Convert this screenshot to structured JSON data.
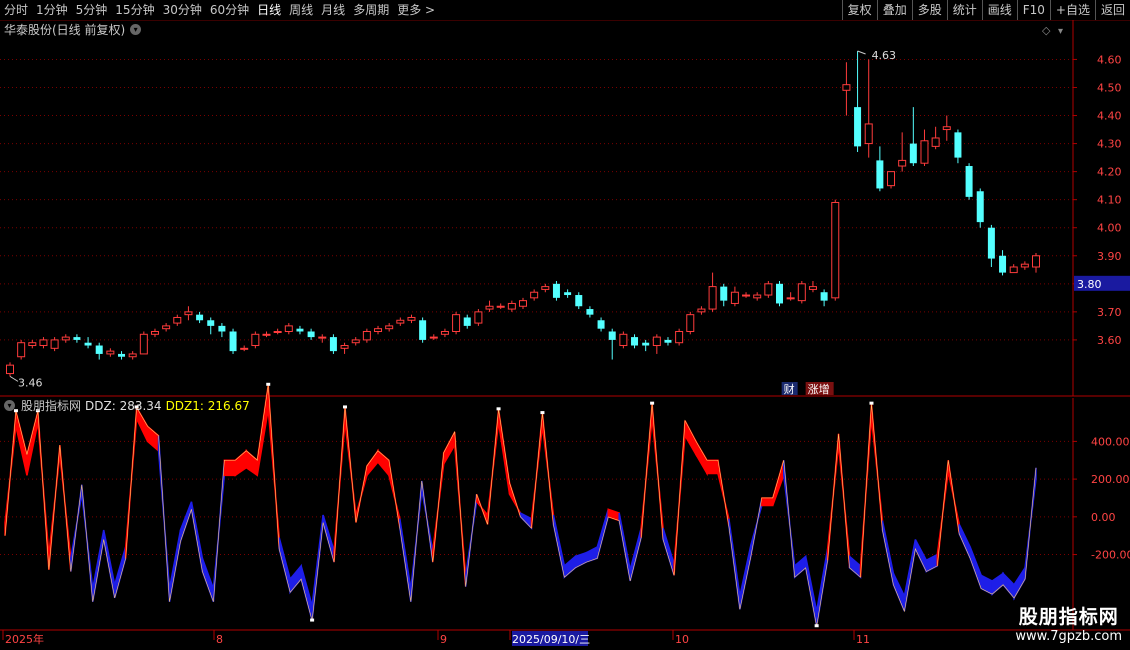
{
  "toolbar": {
    "left_items": [
      "分时",
      "1分钟",
      "5分钟",
      "15分钟",
      "30分钟",
      "60分钟",
      "日线",
      "周线",
      "月线",
      "多周期",
      "更多 >"
    ],
    "active_index": 6,
    "right_items": [
      "复权",
      "叠加",
      "多股",
      "统计",
      "画线",
      "F10",
      "+自选",
      "返回"
    ]
  },
  "title": "华泰股份(日线 前复权)",
  "indicator": {
    "name": "股朋指标网",
    "ddz_label": "DDZ: 283.34",
    "ddz1_label": "DDZ1: 216.67"
  },
  "badges": {
    "cai": "财",
    "zhangzeng": "涨增"
  },
  "watermark": {
    "line1": "股朋指标网",
    "line2": "www.7gpzb.com"
  },
  "colors": {
    "up": "#ff3c3c",
    "down": "#54ffff",
    "grid": "#7a0000",
    "axis_text": "#ff4444",
    "ddz_pos": "#ff0000",
    "ddz_neg": "#1e1ee8",
    "current_price_bg": "#1a1aa0"
  },
  "chart_data": [
    {
      "type": "candlestick",
      "title": "华泰股份(日线 前复权)",
      "y_ticks": [
        "4.60",
        "4.50",
        "4.40",
        "4.30",
        "4.20",
        "4.10",
        "4.00",
        "3.90",
        "3.80",
        "3.70",
        "3.60"
      ],
      "ylim": [
        3.4,
        4.68
      ],
      "grid": true,
      "max_label": "4.63",
      "min_label": "3.46",
      "current_price": "3.80",
      "x_labels": [
        "2025年",
        "8",
        "9",
        "2025/09/10/三",
        "10",
        "11"
      ],
      "candles": [
        [
          3.48,
          3.51,
          3.47,
          3.52
        ],
        [
          3.54,
          3.59,
          3.53,
          3.6
        ],
        [
          3.58,
          3.59,
          3.57,
          3.6
        ],
        [
          3.58,
          3.6,
          3.57,
          3.61
        ],
        [
          3.57,
          3.6,
          3.56,
          3.61
        ],
        [
          3.6,
          3.61,
          3.59,
          3.62
        ],
        [
          3.61,
          3.6,
          3.59,
          3.62
        ],
        [
          3.59,
          3.58,
          3.57,
          3.61
        ],
        [
          3.58,
          3.55,
          3.53,
          3.59
        ],
        [
          3.55,
          3.56,
          3.54,
          3.57
        ],
        [
          3.55,
          3.54,
          3.53,
          3.56
        ],
        [
          3.54,
          3.55,
          3.53,
          3.56
        ],
        [
          3.55,
          3.62,
          3.55,
          3.63
        ],
        [
          3.62,
          3.63,
          3.61,
          3.64
        ],
        [
          3.64,
          3.65,
          3.63,
          3.66
        ],
        [
          3.66,
          3.68,
          3.65,
          3.69
        ],
        [
          3.69,
          3.7,
          3.67,
          3.72
        ],
        [
          3.69,
          3.67,
          3.66,
          3.7
        ],
        [
          3.67,
          3.65,
          3.62,
          3.68
        ],
        [
          3.65,
          3.63,
          3.61,
          3.66
        ],
        [
          3.63,
          3.56,
          3.55,
          3.64
        ],
        [
          3.57,
          3.57,
          3.56,
          3.58
        ],
        [
          3.58,
          3.62,
          3.57,
          3.63
        ],
        [
          3.62,
          3.62,
          3.61,
          3.63
        ],
        [
          3.63,
          3.63,
          3.62,
          3.64
        ],
        [
          3.63,
          3.65,
          3.62,
          3.66
        ],
        [
          3.64,
          3.63,
          3.62,
          3.65
        ],
        [
          3.63,
          3.61,
          3.6,
          3.64
        ],
        [
          3.61,
          3.61,
          3.59,
          3.62
        ],
        [
          3.61,
          3.56,
          3.55,
          3.62
        ],
        [
          3.57,
          3.58,
          3.55,
          3.59
        ],
        [
          3.59,
          3.6,
          3.58,
          3.61
        ],
        [
          3.6,
          3.63,
          3.59,
          3.64
        ],
        [
          3.63,
          3.64,
          3.62,
          3.65
        ],
        [
          3.64,
          3.65,
          3.63,
          3.66
        ],
        [
          3.66,
          3.67,
          3.65,
          3.68
        ],
        [
          3.67,
          3.68,
          3.66,
          3.69
        ],
        [
          3.67,
          3.6,
          3.59,
          3.68
        ],
        [
          3.61,
          3.61,
          3.6,
          3.62
        ],
        [
          3.62,
          3.63,
          3.61,
          3.64
        ],
        [
          3.63,
          3.69,
          3.62,
          3.7
        ],
        [
          3.68,
          3.65,
          3.64,
          3.69
        ],
        [
          3.66,
          3.7,
          3.65,
          3.71
        ],
        [
          3.71,
          3.72,
          3.7,
          3.74
        ],
        [
          3.72,
          3.72,
          3.71,
          3.73
        ],
        [
          3.71,
          3.73,
          3.7,
          3.74
        ],
        [
          3.72,
          3.74,
          3.71,
          3.75
        ],
        [
          3.75,
          3.77,
          3.74,
          3.78
        ],
        [
          3.78,
          3.79,
          3.77,
          3.8
        ],
        [
          3.8,
          3.75,
          3.74,
          3.81
        ],
        [
          3.77,
          3.76,
          3.75,
          3.78
        ],
        [
          3.76,
          3.72,
          3.71,
          3.77
        ],
        [
          3.71,
          3.69,
          3.68,
          3.72
        ],
        [
          3.67,
          3.64,
          3.63,
          3.68
        ],
        [
          3.63,
          3.6,
          3.53,
          3.64
        ],
        [
          3.58,
          3.62,
          3.57,
          3.63
        ],
        [
          3.61,
          3.58,
          3.57,
          3.62
        ],
        [
          3.59,
          3.58,
          3.56,
          3.6
        ],
        [
          3.58,
          3.61,
          3.55,
          3.62
        ],
        [
          3.6,
          3.59,
          3.58,
          3.61
        ],
        [
          3.59,
          3.63,
          3.58,
          3.64
        ],
        [
          3.63,
          3.69,
          3.62,
          3.7
        ],
        [
          3.7,
          3.71,
          3.69,
          3.72
        ],
        [
          3.71,
          3.79,
          3.7,
          3.84
        ],
        [
          3.79,
          3.74,
          3.72,
          3.8
        ],
        [
          3.73,
          3.77,
          3.72,
          3.79
        ],
        [
          3.76,
          3.76,
          3.75,
          3.77
        ],
        [
          3.75,
          3.76,
          3.74,
          3.77
        ],
        [
          3.76,
          3.8,
          3.75,
          3.81
        ],
        [
          3.8,
          3.73,
          3.72,
          3.81
        ],
        [
          3.75,
          3.75,
          3.74,
          3.77
        ],
        [
          3.74,
          3.8,
          3.73,
          3.81
        ],
        [
          3.78,
          3.79,
          3.77,
          3.81
        ],
        [
          3.77,
          3.74,
          3.72,
          3.78
        ],
        [
          3.75,
          4.09,
          3.74,
          4.1
        ],
        [
          4.49,
          4.51,
          4.4,
          4.59
        ],
        [
          4.43,
          4.29,
          4.27,
          4.63
        ],
        [
          4.3,
          4.37,
          4.25,
          4.6
        ],
        [
          4.24,
          4.14,
          4.13,
          4.29
        ],
        [
          4.15,
          4.2,
          4.14,
          4.2
        ],
        [
          4.22,
          4.24,
          4.2,
          4.34
        ],
        [
          4.3,
          4.23,
          4.22,
          4.43
        ],
        [
          4.23,
          4.31,
          4.22,
          4.35
        ],
        [
          4.29,
          4.32,
          4.28,
          4.36
        ],
        [
          4.35,
          4.36,
          4.31,
          4.4
        ],
        [
          4.34,
          4.25,
          4.23,
          4.35
        ],
        [
          4.22,
          4.11,
          4.1,
          4.23
        ],
        [
          4.13,
          4.02,
          4.0,
          4.14
        ],
        [
          4.0,
          3.89,
          3.86,
          4.01
        ],
        [
          3.9,
          3.84,
          3.83,
          3.92
        ],
        [
          3.84,
          3.86,
          3.84,
          3.87
        ],
        [
          3.86,
          3.87,
          3.85,
          3.88
        ],
        [
          3.86,
          3.9,
          3.84,
          3.91
        ]
      ]
    },
    {
      "type": "band",
      "series": [
        {
          "name": "DDZ"
        },
        {
          "name": "DDZ1"
        }
      ],
      "y_ticks": [
        "400.00",
        "200.00",
        "0.00",
        "-200.00"
      ],
      "ylim": [
        -600,
        630
      ],
      "x": [
        0,
        1,
        2,
        3,
        4,
        5,
        6,
        7,
        8,
        9,
        10,
        11,
        12,
        13,
        14,
        15,
        16,
        17,
        18,
        19,
        20,
        21,
        22,
        23,
        24,
        25,
        26,
        27,
        28,
        29,
        30,
        31,
        32,
        33,
        34,
        35,
        36,
        37,
        38,
        39,
        40,
        41,
        42,
        43,
        44,
        45,
        46,
        47,
        48,
        49,
        50,
        51,
        52,
        53,
        54,
        55,
        56,
        57,
        58,
        59,
        60,
        61,
        62,
        63,
        64,
        65,
        66,
        67,
        68,
        69,
        70,
        71,
        72,
        73,
        74,
        75,
        76,
        77,
        78,
        79,
        80,
        81,
        82,
        83,
        84,
        85,
        86,
        87,
        88,
        89,
        90,
        91,
        92,
        93,
        94
      ],
      "ddz": [
        -100,
        560,
        330,
        560,
        -280,
        380,
        -290,
        170,
        -450,
        -120,
        -430,
        -220,
        580,
        480,
        430,
        -450,
        -130,
        40,
        -290,
        -450,
        300,
        300,
        350,
        300,
        700,
        -170,
        -400,
        -330,
        -550,
        -30,
        -240,
        580,
        -30,
        270,
        350,
        300,
        -60,
        -450,
        190,
        -240,
        340,
        450,
        -370,
        120,
        -40,
        570,
        180,
        0,
        -60,
        550,
        -40,
        -320,
        -270,
        -240,
        -220,
        0,
        -20,
        -340,
        -110,
        600,
        -120,
        -310,
        510,
        400,
        300,
        300,
        -50,
        -490,
        -210,
        100,
        100,
        300,
        -320,
        -270,
        -580,
        -230,
        440,
        -270,
        -320,
        600,
        -70,
        -360,
        -500,
        -170,
        -290,
        -260,
        300,
        -90,
        -220,
        -380,
        -410,
        -360,
        -430,
        -330,
        260
      ],
      "ddz1": [
        -30,
        480,
        220,
        500,
        -200,
        330,
        -220,
        120,
        -380,
        -70,
        -360,
        -160,
        520,
        400,
        350,
        -380,
        -70,
        80,
        -220,
        -380,
        220,
        220,
        260,
        220,
        570,
        -110,
        -330,
        -260,
        -470,
        10,
        -180,
        500,
        10,
        220,
        290,
        220,
        -10,
        -380,
        140,
        -180,
        280,
        380,
        -310,
        80,
        10,
        500,
        120,
        20,
        -10,
        480,
        10,
        -260,
        -210,
        -190,
        -160,
        40,
        20,
        -280,
        -60,
        520,
        -60,
        -250,
        430,
        330,
        230,
        230,
        -10,
        -420,
        -150,
        60,
        60,
        220,
        -260,
        -210,
        -500,
        -170,
        380,
        -210,
        -260,
        520,
        -20,
        -300,
        -420,
        -120,
        -230,
        -200,
        240,
        -40,
        -160,
        -310,
        -340,
        -300,
        -360,
        -270,
        200
      ]
    }
  ]
}
